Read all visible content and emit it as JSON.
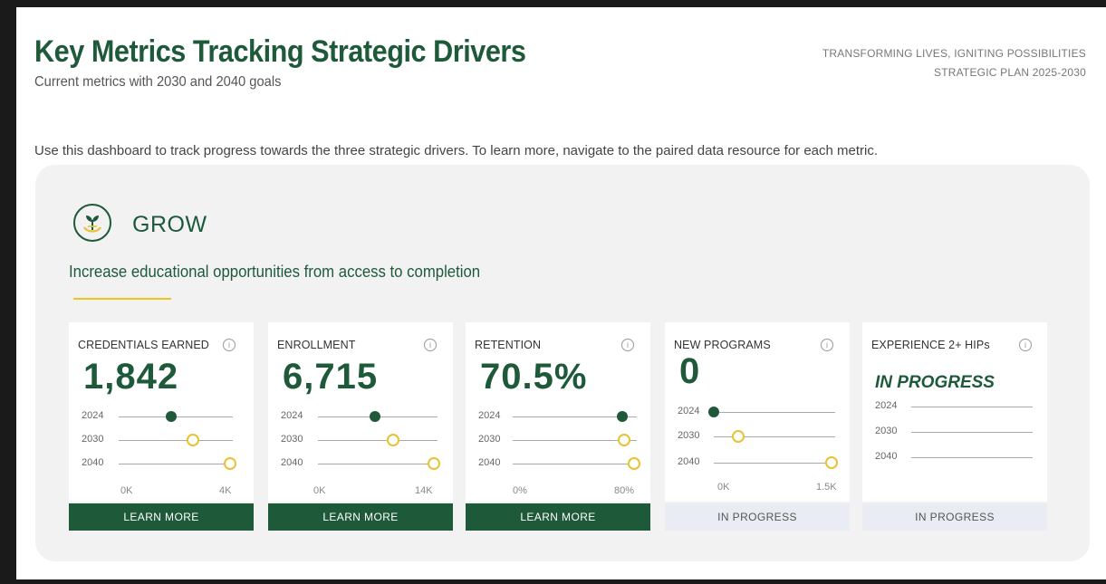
{
  "header": {
    "title": "Key Metrics Tracking Strategic Drivers",
    "subtitle": "Current metrics with 2030 and 2040 goals",
    "tagline_line1": "TRANSFORMING LIVES, IGNITING POSSIBILITIES",
    "tagline_line2": "STRATEGIC PLAN 2025-2030"
  },
  "intro": "Use this dashboard to track progress towards the three strategic drivers. To learn more, navigate to the paired data resource for each metric.",
  "colors": {
    "primary_green": "#1e5a3a",
    "accent_gold": "#f0c419",
    "goal_ring": "#e8c232",
    "panel_bg": "#f2f2f2",
    "status_bg": "#e9edf3"
  },
  "driver": {
    "icon": "sprout-icon",
    "title": "GROW",
    "description": "Increase educational opportunities from access to completion"
  },
  "cards": [
    {
      "title": "CREDENTIALS EARNED",
      "value": "1,842",
      "years": [
        "2024",
        "2030",
        "2040"
      ],
      "axis_min": "0K",
      "axis_max": "4K",
      "scale_max": 4000,
      "current_2024": 1842,
      "goal_2030": 2600,
      "goal_2040": 3900,
      "action_label": "LEARN MORE"
    },
    {
      "title": "ENROLLMENT",
      "value": "6,715",
      "years": [
        "2024",
        "2030",
        "2040"
      ],
      "axis_min": "0K",
      "axis_max": "14K",
      "scale_max": 14000,
      "current_2024": 6715,
      "goal_2030": 8800,
      "goal_2040": 13600,
      "action_label": "LEARN MORE"
    },
    {
      "title": "RETENTION",
      "value": "70.5%",
      "years": [
        "2024",
        "2030",
        "2040"
      ],
      "axis_min": "0%",
      "axis_max": "80%",
      "scale_max": 80,
      "current_2024": 70.5,
      "goal_2030": 72,
      "goal_2040": 78,
      "action_label": "LEARN MORE"
    },
    {
      "title": "NEW PROGRAMS",
      "value": "0",
      "years": [
        "2024",
        "2030",
        "2040"
      ],
      "axis_min": "0K",
      "axis_max": "1.5K",
      "scale_max": 1500,
      "current_2024": 0,
      "goal_2030": 300,
      "goal_2040": 1450,
      "status_label": "IN PROGRESS"
    },
    {
      "title": "EXPERIENCE 2+ HIPs",
      "value": "IN PROGRESS",
      "years": [
        "2024",
        "2030",
        "2040"
      ],
      "status_label": "IN PROGRESS"
    }
  ]
}
